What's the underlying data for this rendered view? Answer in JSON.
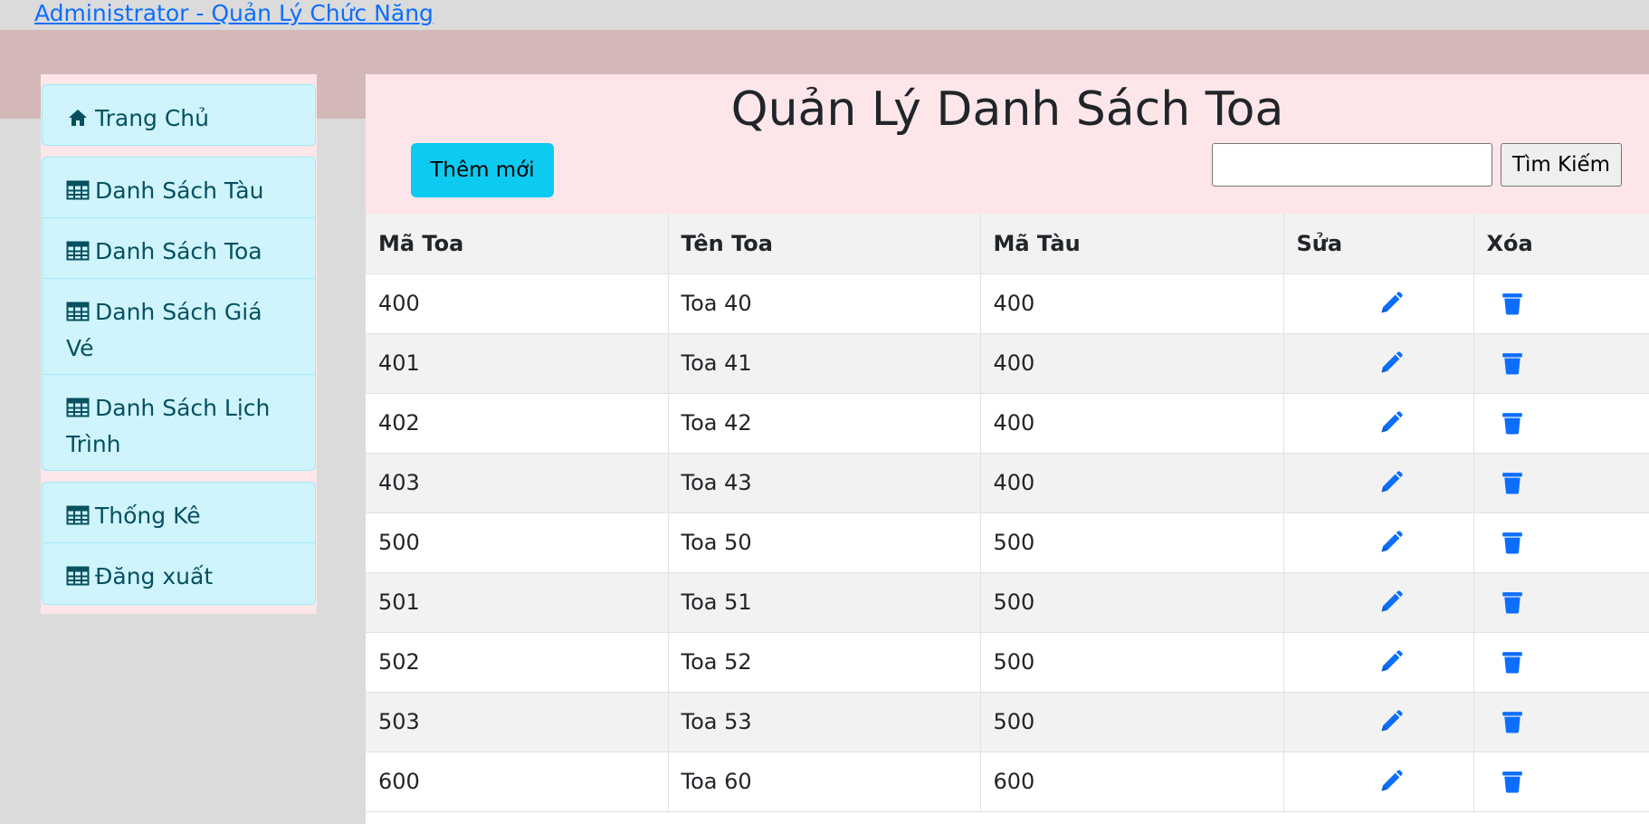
{
  "header": {
    "admin_link": "Administrator - Quản Lý Chức Năng"
  },
  "sidebar": {
    "groups": [
      {
        "items": [
          {
            "label": "Trang Chủ",
            "icon": "home-icon"
          }
        ]
      },
      {
        "items": [
          {
            "label": "Danh Sách Tàu",
            "icon": "table-icon"
          },
          {
            "label": "Danh Sách Toa",
            "icon": "table-icon"
          },
          {
            "label": "Danh Sách Giá Vé",
            "icon": "table-icon"
          },
          {
            "label": "Danh Sách Lịch Trình",
            "icon": "table-icon"
          }
        ]
      },
      {
        "items": [
          {
            "label": "Thống Kê",
            "icon": "table-icon"
          },
          {
            "label": "Đăng xuất",
            "icon": "table-icon"
          }
        ]
      }
    ]
  },
  "main": {
    "title": "Quản Lý Danh Sách Toa",
    "add_button": "Thêm mới",
    "search": {
      "value": "",
      "placeholder": "",
      "button": "Tìm Kiếm"
    },
    "table": {
      "columns": [
        "Mã Toa",
        "Tên Toa",
        "Mã Tàu",
        "Sửa",
        "Xóa"
      ],
      "rows": [
        [
          "400",
          "Toa 40",
          "400"
        ],
        [
          "401",
          "Toa 41",
          "400"
        ],
        [
          "402",
          "Toa 42",
          "400"
        ],
        [
          "403",
          "Toa 43",
          "400"
        ],
        [
          "500",
          "Toa 50",
          "500"
        ],
        [
          "501",
          "Toa 51",
          "500"
        ],
        [
          "502",
          "Toa 52",
          "500"
        ],
        [
          "503",
          "Toa 53",
          "500"
        ],
        [
          "600",
          "Toa 60",
          "600"
        ]
      ]
    }
  },
  "colors": {
    "link": "#0d6efd",
    "sidebar_item_bg": "#cff4fc",
    "sidebar_item_text": "#055160",
    "header_bg": "#fce6ea",
    "primary_button": "#0dcaf0",
    "action_icon": "#0d6efd"
  }
}
